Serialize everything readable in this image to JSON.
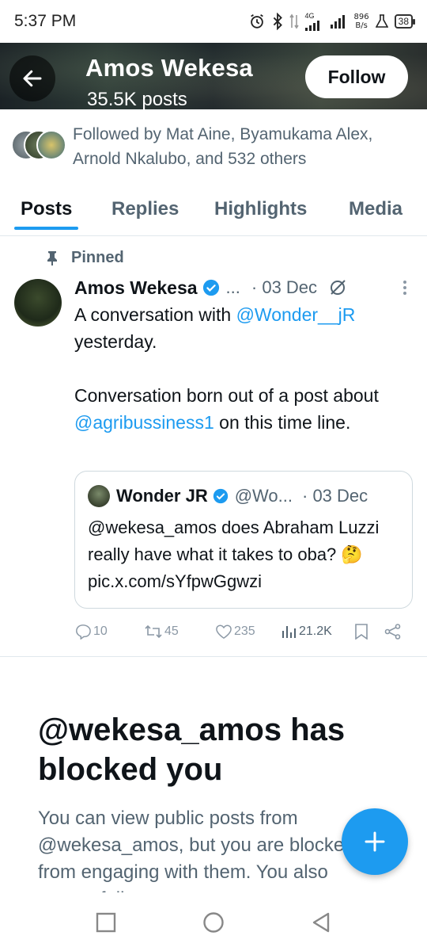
{
  "status_bar": {
    "time": "5:37 PM",
    "net_speed_value": "896",
    "net_speed_unit": "B/s",
    "network_type": "4G",
    "battery": "38"
  },
  "header": {
    "name": "Amos Wekesa",
    "posts_count": "35.5K posts",
    "follow_label": "Follow"
  },
  "followed_by": {
    "text": "Followed by Mat Aine, Byamukama Alex, Arnold Nkalubo, and 532 others"
  },
  "tabs": [
    {
      "label": "Posts",
      "active": true
    },
    {
      "label": "Replies",
      "active": false
    },
    {
      "label": "Highlights",
      "active": false
    },
    {
      "label": "Media",
      "active": false
    }
  ],
  "post": {
    "pinned_label": "Pinned",
    "author": "Amos Wekesa",
    "handle": "...",
    "date": "· 03 Dec",
    "body_line1_prefix": "A conversation with ",
    "body_line1_mention": "@Wonder__jR",
    "body_line1_suffix": " yesterday.",
    "body_line2_prefix": "Conversation born out of a post about ",
    "body_line2_mention": "@agribussiness1",
    "body_line2_suffix": " on this time line.",
    "quote": {
      "author": "Wonder JR",
      "handle": "@Wo...",
      "date": "· 03 Dec",
      "body": "@wekesa_amos does Abraham Luzzi really have what it takes to oba? 🤔 pic.x.com/sYfpwGgwzi"
    },
    "actions": {
      "replies": "10",
      "reposts": "45",
      "likes": "235",
      "views": "21.2K"
    }
  },
  "blocked": {
    "title": "@wekesa_amos has blocked you",
    "description": "You can view public posts from @wekesa_amos, but you are blocked from engaging with them. You also cannot follow"
  },
  "colors": {
    "accent": "#1d9bf0",
    "text_primary": "#0f1419",
    "text_secondary": "#536471"
  }
}
